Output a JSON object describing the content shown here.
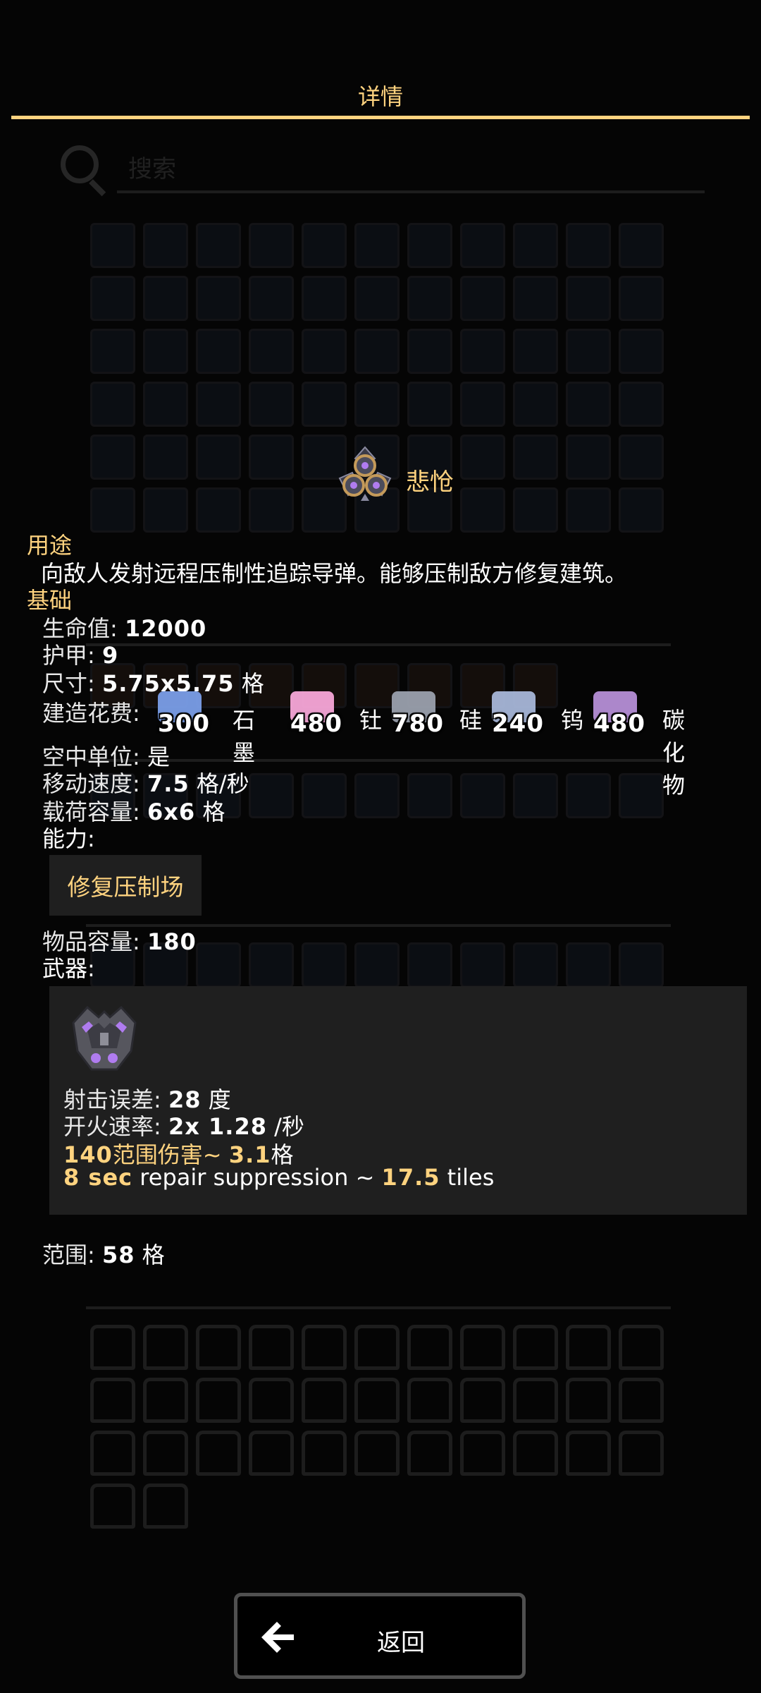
{
  "header": {
    "title": "详情"
  },
  "background": {
    "search_placeholder": "搜索"
  },
  "unit": {
    "name": "悲怆",
    "icon": "quell-unit-icon"
  },
  "usage": {
    "label": "用途",
    "description": "向敌人发射远程压制性追踪导弹。能够压制敌方修复建筑。"
  },
  "basic": {
    "label": "基础",
    "health": {
      "label": "生命值: ",
      "value": "12000"
    },
    "armor": {
      "label": "护甲: ",
      "value": "9"
    },
    "size": {
      "label": "尺寸: ",
      "value": "5.75x5.75",
      "unit": " 格"
    },
    "build_cost": {
      "label": "建造花费:",
      "items": [
        {
          "amount": "300",
          "name": "石墨",
          "color": "#7a9ee8"
        },
        {
          "amount": "480",
          "name": "钍",
          "color": "#f7a6d8"
        },
        {
          "amount": "780",
          "name": "硅",
          "color": "#9aa0ad"
        },
        {
          "amount": "240",
          "name": "钨",
          "color": "#a7b6d8"
        },
        {
          "amount": "480",
          "name": "碳化物",
          "color": "#b58ed6"
        }
      ]
    },
    "air_unit": {
      "label": "空中单位: ",
      "value": "是"
    },
    "speed": {
      "label": "移动速度: ",
      "value": "7.5",
      "unit": " 格/秒"
    },
    "payload": {
      "label": "载荷容量: ",
      "value": "6x6",
      "unit": " 格"
    },
    "abilities": {
      "label": "能力:",
      "items": [
        "修复压制场"
      ]
    },
    "item_capacity": {
      "label": "物品容量: ",
      "value": "180"
    },
    "weapons": {
      "label": "武器:",
      "icon": "missile-launcher-icon",
      "inaccuracy": {
        "label": "射击误差: ",
        "value": "28",
        "unit": " 度"
      },
      "fire_rate": {
        "label": "开火速率: ",
        "value": "2x 1.28",
        "unit": " /秒"
      },
      "splash": {
        "value": "140",
        "label": "范围伤害~ ",
        "range": "3.1",
        "unit": "格"
      },
      "suppression": {
        "prefix": "8 sec",
        "text": " repair suppression ~ ",
        "value": "17.5",
        "unit": " tiles"
      }
    },
    "range": {
      "label": "范围: ",
      "value": "58",
      "unit": " 格"
    }
  },
  "back_button": {
    "label": "返回",
    "icon": "arrow-left-icon"
  }
}
